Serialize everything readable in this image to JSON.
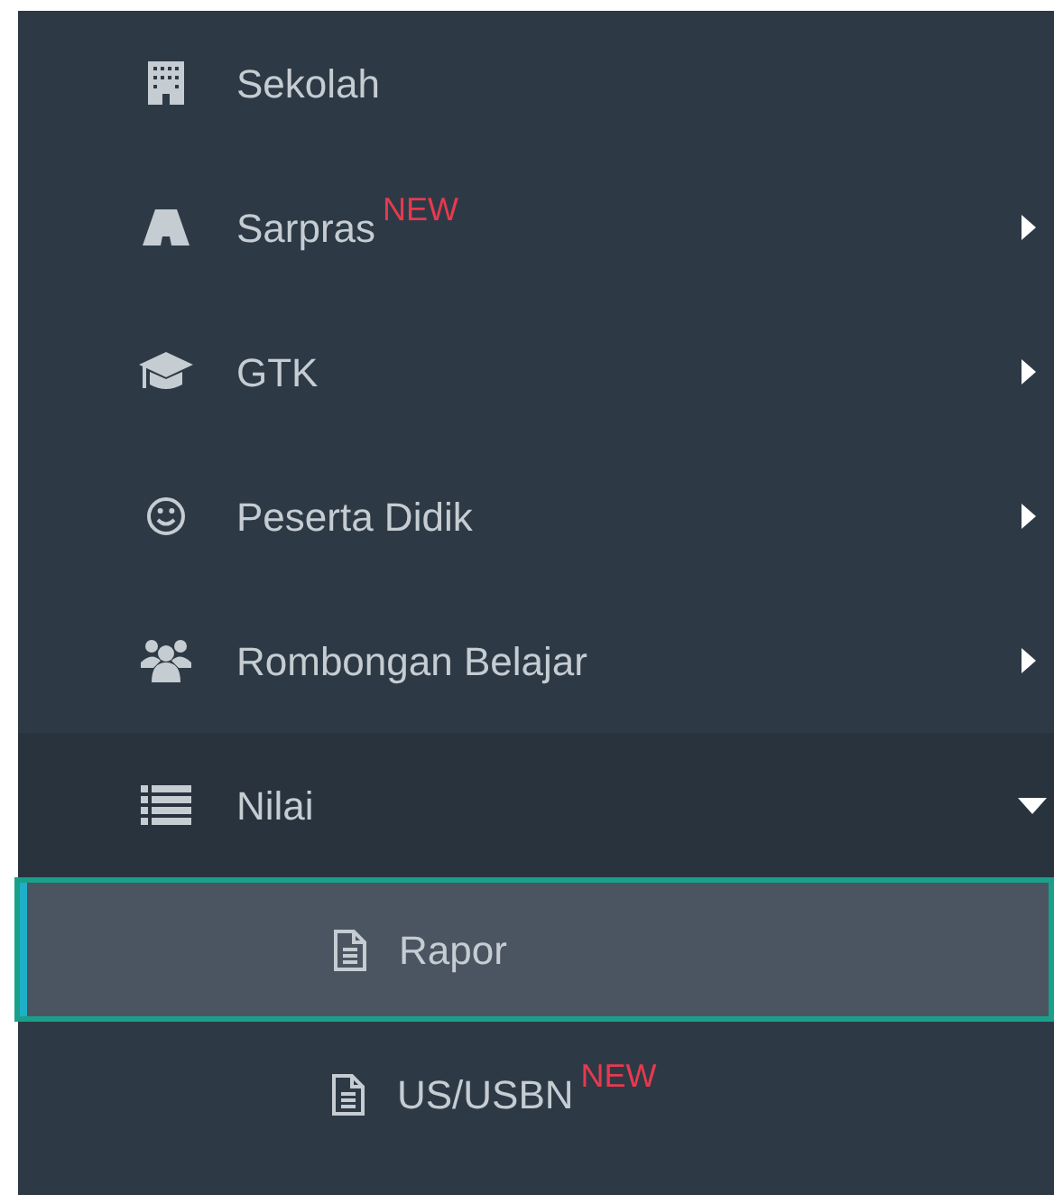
{
  "menu": [
    {
      "label": "Sekolah",
      "selected": false
    },
    {
      "label": "Sarpras",
      "badge": "NEW",
      "expanded": false,
      "selected": false
    },
    {
      "label": "GTK",
      "expanded": false,
      "selected": false
    },
    {
      "label": "Peserta Didik",
      "expanded": false,
      "selected": false
    },
    {
      "label": "Rombongan Belajar",
      "expanded": false,
      "selected": false
    },
    {
      "label": "Nilai",
      "expanded": true,
      "selected": false,
      "children": [
        {
          "label": "Rapor",
          "selected": true
        },
        {
          "label": "US/USBN",
          "badge": "NEW",
          "selected": false
        }
      ]
    }
  ]
}
